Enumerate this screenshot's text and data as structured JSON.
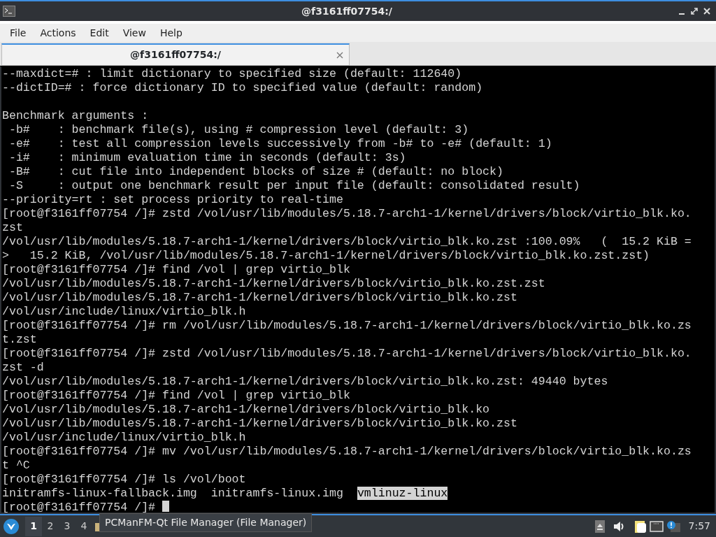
{
  "window": {
    "title": "@f3161ff07754:/"
  },
  "menu": [
    "File",
    "Actions",
    "Edit",
    "View",
    "Help"
  ],
  "tabs": [
    {
      "label": "@f3161ff07754:/",
      "selected": true
    }
  ],
  "terminal": {
    "lines": [
      {
        "kind": "text",
        "text": "--maxdict=# : limit dictionary to specified size (default: 112640)"
      },
      {
        "kind": "text",
        "text": "--dictID=# : force dictionary ID to specified value (default: random)"
      },
      {
        "kind": "blank"
      },
      {
        "kind": "text",
        "text": "Benchmark arguments :"
      },
      {
        "kind": "text",
        "text": " -b#    : benchmark file(s), using # compression level (default: 3)"
      },
      {
        "kind": "text",
        "text": " -e#    : test all compression levels successively from -b# to -e# (default: 1)"
      },
      {
        "kind": "text",
        "text": " -i#    : minimum evaluation time in seconds (default: 3s)"
      },
      {
        "kind": "text",
        "text": " -B#    : cut file into independent blocks of size # (default: no block)"
      },
      {
        "kind": "text",
        "text": " -S     : output one benchmark result per input file (default: consolidated result)"
      },
      {
        "kind": "text",
        "text": "--priority=rt : set process priority to real-time"
      },
      {
        "kind": "text",
        "text": "[root@f3161ff07754 /]# zstd /vol/usr/lib/modules/5.18.7-arch1-1/kernel/drivers/block/virtio_blk.ko."
      },
      {
        "kind": "text",
        "text": "zst"
      },
      {
        "kind": "text",
        "text": "/vol/usr/lib/modules/5.18.7-arch1-1/kernel/drivers/block/virtio_blk.ko.zst :100.09%   (  15.2 KiB ="
      },
      {
        "kind": "text",
        "text": ">   15.2 KiB, /vol/usr/lib/modules/5.18.7-arch1-1/kernel/drivers/block/virtio_blk.ko.zst.zst)"
      },
      {
        "kind": "text",
        "text": "[root@f3161ff07754 /]# find /vol | grep virtio_blk"
      },
      {
        "kind": "text",
        "text": "/vol/usr/lib/modules/5.18.7-arch1-1/kernel/drivers/block/virtio_blk.ko.zst.zst"
      },
      {
        "kind": "text",
        "text": "/vol/usr/lib/modules/5.18.7-arch1-1/kernel/drivers/block/virtio_blk.ko.zst"
      },
      {
        "kind": "text",
        "text": "/vol/usr/include/linux/virtio_blk.h"
      },
      {
        "kind": "text",
        "text": "[root@f3161ff07754 /]# rm /vol/usr/lib/modules/5.18.7-arch1-1/kernel/drivers/block/virtio_blk.ko.zs"
      },
      {
        "kind": "text",
        "text": "t.zst"
      },
      {
        "kind": "text",
        "text": "[root@f3161ff07754 /]# zstd /vol/usr/lib/modules/5.18.7-arch1-1/kernel/drivers/block/virtio_blk.ko."
      },
      {
        "kind": "text",
        "text": "zst -d"
      },
      {
        "kind": "text",
        "text": "/vol/usr/lib/modules/5.18.7-arch1-1/kernel/drivers/block/virtio_blk.ko.zst: 49440 bytes"
      },
      {
        "kind": "text",
        "text": "[root@f3161ff07754 /]# find /vol | grep virtio_blk"
      },
      {
        "kind": "text",
        "text": "/vol/usr/lib/modules/5.18.7-arch1-1/kernel/drivers/block/virtio_blk.ko"
      },
      {
        "kind": "text",
        "text": "/vol/usr/lib/modules/5.18.7-arch1-1/kernel/drivers/block/virtio_blk.ko.zst"
      },
      {
        "kind": "text",
        "text": "/vol/usr/include/linux/virtio_blk.h"
      },
      {
        "kind": "text",
        "text": "[root@f3161ff07754 /]# mv /vol/usr/lib/modules/5.18.7-arch1-1/kernel/drivers/block/virtio_blk.ko.zs"
      },
      {
        "kind": "text",
        "text": "t ^C"
      },
      {
        "kind": "text",
        "text": "[root@f3161ff07754 /]# ls /vol/boot"
      },
      {
        "kind": "files",
        "items": [
          {
            "name": "initramfs-linux-fallback.img",
            "selected": false
          },
          {
            "name": "initramfs-linux.img",
            "selected": false
          },
          {
            "name": "vmlinuz-linux",
            "selected": true
          }
        ]
      },
      {
        "kind": "prompt",
        "text": "[root@f3161ff07754 /]#",
        "cursor": true
      }
    ]
  },
  "taskbar": {
    "desktops": [
      {
        "label": "1",
        "selected": true
      },
      {
        "label": "2",
        "selected": false
      },
      {
        "label": "3",
        "selected": false
      },
      {
        "label": "4",
        "selected": false
      }
    ],
    "tooltip": "PCManFM-Qt File Manager (File Manager)",
    "clock": "7:57"
  }
}
